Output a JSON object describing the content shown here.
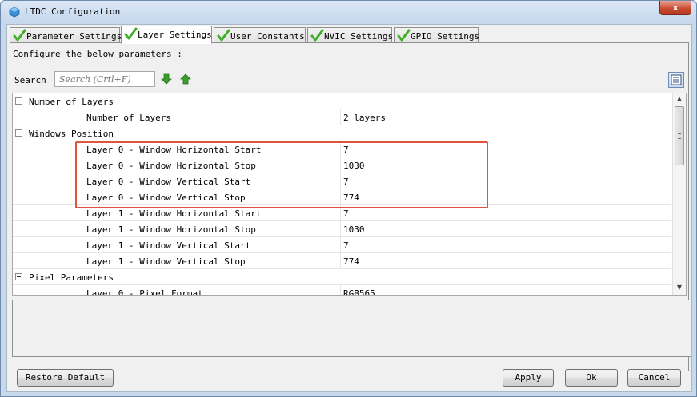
{
  "window": {
    "title": "LTDC Configuration",
    "close_label": "x"
  },
  "tabs": [
    {
      "label": "Parameter Settings"
    },
    {
      "label": "Layer Settings"
    },
    {
      "label": "User Constants"
    },
    {
      "label": "NVIC Settings"
    },
    {
      "label": "GPIO Settings"
    }
  ],
  "active_tab": "Layer Settings",
  "panel": {
    "instructions": "Configure the below parameters :",
    "search_label": "Search :",
    "search_placeholder": "Search (Crtl+F)"
  },
  "grid": {
    "rows": [
      {
        "type": "category",
        "label": "Number of Layers"
      },
      {
        "type": "param",
        "name": "Number of Layers",
        "value": "2 layers"
      },
      {
        "type": "category",
        "label": "Windows Position"
      },
      {
        "type": "param",
        "name": "Layer 0 - Window Horizontal Start",
        "value": "7"
      },
      {
        "type": "param",
        "name": "Layer 0 - Window Horizontal Stop",
        "value": "1030"
      },
      {
        "type": "param",
        "name": "Layer 0 - Window Vertical Start",
        "value": "7"
      },
      {
        "type": "param",
        "name": "Layer 0 - Window Vertical Stop",
        "value": "774"
      },
      {
        "type": "param",
        "name": "Layer 1 - Window Horizontal Start",
        "value": "7"
      },
      {
        "type": "param",
        "name": "Layer 1 - Window Horizontal Stop",
        "value": "1030"
      },
      {
        "type": "param",
        "name": "Layer 1 - Window Vertical Start",
        "value": "7"
      },
      {
        "type": "param",
        "name": "Layer 1 - Window Vertical Stop",
        "value": "774"
      },
      {
        "type": "category",
        "label": "Pixel Parameters"
      },
      {
        "type": "param",
        "name": "Layer 0 - Pixel Format",
        "value": "RGB565"
      }
    ]
  },
  "buttons": {
    "restore_default": "Restore Default",
    "apply": "Apply",
    "ok": "Ok",
    "cancel": "Cancel"
  },
  "colors": {
    "check_green": "#3fae2a",
    "arrow_green": "#3a9e2a",
    "highlight_border": "#e0533e"
  }
}
